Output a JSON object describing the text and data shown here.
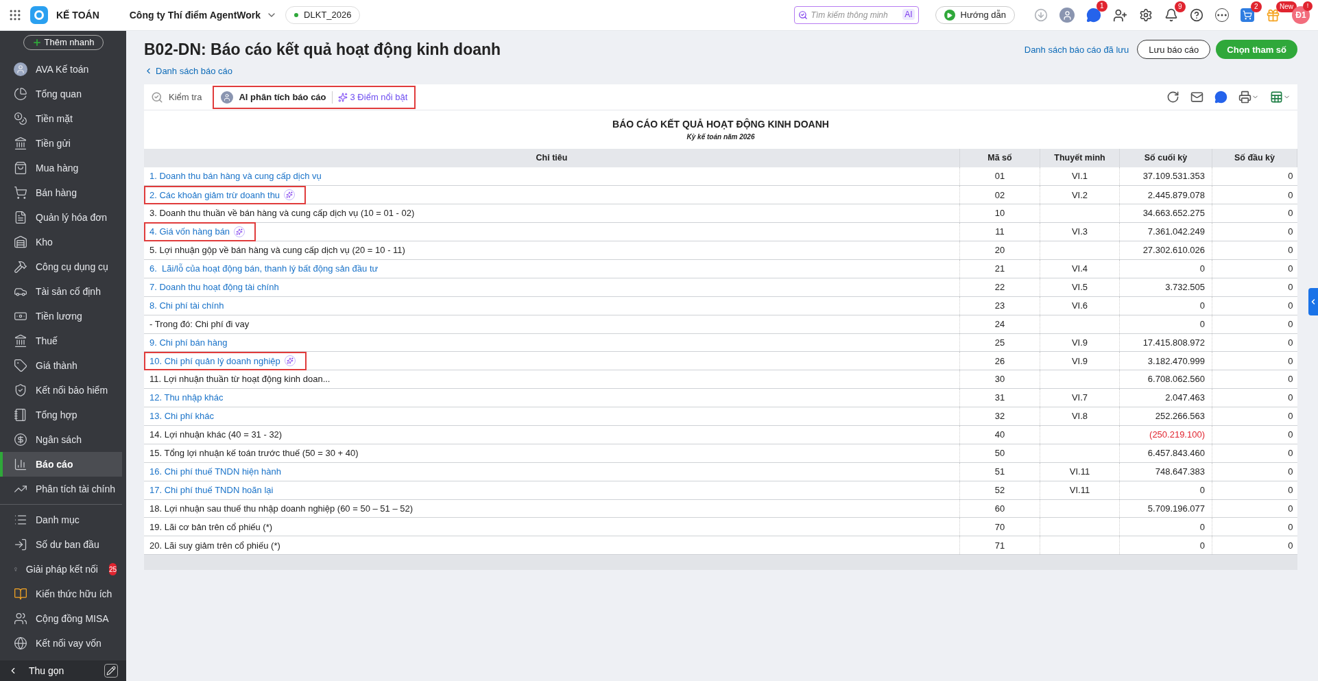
{
  "topbar": {
    "app_name": "KẾ TOÁN",
    "company": "Công ty Thí điểm AgentWork",
    "database": "DLKT_2026",
    "search": {
      "placeholder": "Tìm kiếm thông minh",
      "badge": "AI"
    },
    "guide_button": "Hướng dẫn",
    "icons": [
      {
        "kind": "download"
      },
      {
        "kind": "ai-avatar"
      },
      {
        "kind": "chat",
        "badge": "1"
      },
      {
        "kind": "add-user"
      },
      {
        "kind": "settings"
      },
      {
        "kind": "bell",
        "badge": "9"
      },
      {
        "kind": "help"
      },
      {
        "kind": "more"
      },
      {
        "kind": "cart",
        "badge": "2"
      },
      {
        "kind": "gift",
        "badge": "New"
      }
    ],
    "user": {
      "initials": "Đ1",
      "badge": "!"
    }
  },
  "sidebar": {
    "quick_add": "Thêm nhanh",
    "groups": [
      [
        {
          "label": "AVA Kế toán",
          "kind": "avatar",
          "selected": false
        },
        {
          "label": "Tổng quan",
          "kind": "overview",
          "selected": false
        },
        {
          "label": "Tiền mặt",
          "kind": "cash",
          "selected": false
        },
        {
          "label": "Tiền gửi",
          "kind": "deposit",
          "selected": false
        },
        {
          "label": "Mua hàng",
          "kind": "purchase",
          "selected": false
        },
        {
          "label": "Bán hàng",
          "kind": "sales",
          "selected": false
        },
        {
          "label": "Quản lý hóa đơn",
          "kind": "invoice",
          "selected": false
        },
        {
          "label": "Kho",
          "kind": "warehouse",
          "selected": false
        },
        {
          "label": "Công cụ dụng cụ",
          "kind": "tools",
          "selected": false
        },
        {
          "label": "Tài sản cố định",
          "kind": "asset",
          "selected": false
        },
        {
          "label": "Tiền lương",
          "kind": "salary",
          "selected": false
        },
        {
          "label": "Thuế",
          "kind": "tax",
          "selected": false
        },
        {
          "label": "Giá thành",
          "kind": "cost",
          "selected": false
        },
        {
          "label": "Kết nối bảo hiểm",
          "kind": "insurance",
          "selected": false
        },
        {
          "label": "Tổng hợp",
          "kind": "ledger",
          "selected": false
        },
        {
          "label": "Ngân sách",
          "kind": "budget",
          "selected": false
        },
        {
          "label": "Báo cáo",
          "kind": "report",
          "selected": true
        },
        {
          "label": "Phân tích tài chính",
          "kind": "analysis",
          "selected": false
        }
      ],
      [
        {
          "label": "Danh mục",
          "kind": "list",
          "selected": false
        },
        {
          "label": "Số dư ban đầu",
          "kind": "opening",
          "selected": false
        },
        {
          "label": "Giải pháp kết nối",
          "kind": "solution",
          "selected": false,
          "badge": "25"
        },
        {
          "label": "Kiến thức hữu ích",
          "kind": "knowledge",
          "selected": false
        },
        {
          "label": "Cộng đồng MISA",
          "kind": "community",
          "selected": false
        },
        {
          "label": "Kết nối vay vốn",
          "kind": "loan",
          "selected": false
        }
      ]
    ],
    "collapse": "Thu gọn"
  },
  "page": {
    "title": "B02-DN: Báo cáo kết quả hoạt động kinh doanh",
    "back_link": "Danh sách báo cáo",
    "saved_reports_link": "Danh sách báo cáo đã lưu",
    "save_button": "Lưu báo cáo",
    "params_button": "Chọn tham số"
  },
  "toolbar": {
    "check": "Kiểm tra",
    "ai_analysis": "AI phân tích báo cáo",
    "highlights": "3 Điểm nổi bật",
    "highlighted": true
  },
  "report": {
    "title": "BÁO CÁO KẾT QUẢ HOẠT ĐỘNG KINH DOANH",
    "subtitle": "Kỳ kế toán năm 2026",
    "columns": [
      "Chỉ tiêu",
      "Mã số",
      "Thuyết minh",
      "Số cuối kỳ",
      "Số đầu kỳ"
    ],
    "rows": [
      {
        "label": "1. Doanh thu bán hàng và cung cấp dịch vụ",
        "code": "01",
        "note": "VI.1",
        "end": "37.109.531.353",
        "start": "0",
        "link": true,
        "highlighted": false,
        "negative": false
      },
      {
        "label": "2. Các khoản giảm trừ doanh thu",
        "code": "02",
        "note": "VI.2",
        "end": "2.445.879.078",
        "start": "0",
        "link": true,
        "highlighted": true,
        "negative": false
      },
      {
        "label": "3. Doanh thu thuần về bán hàng và cung cấp dịch vụ (10 = 01 - 02)",
        "code": "10",
        "end": "34.663.652.275",
        "start": "0",
        "link": false,
        "highlighted": false,
        "negative": false
      },
      {
        "label": "4. Giá vốn hàng bán",
        "code": "11",
        "note": "VI.3",
        "end": "7.361.042.249",
        "start": "0",
        "link": true,
        "highlighted": true,
        "negative": false
      },
      {
        "label": "5. Lợi nhuận gộp về bán hàng và cung cấp dịch vụ (20 = 10 - 11)",
        "code": "20",
        "end": "27.302.610.026",
        "start": "0",
        "link": false,
        "highlighted": false,
        "negative": false
      },
      {
        "label": "6.  Lãi/lỗ của hoạt động bán, thanh lý bất động sản đầu tư",
        "code": "21",
        "note": "VI.4",
        "end": "0",
        "start": "0",
        "link": true,
        "highlighted": false,
        "negative": false
      },
      {
        "label": "7. Doanh thu hoạt động tài chính",
        "code": "22",
        "note": "VI.5",
        "end": "3.732.505",
        "start": "0",
        "link": true,
        "highlighted": false,
        "negative": false
      },
      {
        "label": "8. Chi phí tài chính",
        "code": "23",
        "note": "VI.6",
        "end": "0",
        "start": "0",
        "link": true,
        "highlighted": false,
        "negative": false
      },
      {
        "label": "- Trong đó: Chi phí đi vay",
        "code": "24",
        "end": "0",
        "start": "0",
        "link": false,
        "highlighted": false,
        "negative": false
      },
      {
        "label": "9. Chi phí bán hàng",
        "code": "25",
        "note": "VI.9",
        "end": "17.415.808.972",
        "start": "0",
        "link": true,
        "highlighted": false,
        "negative": false
      },
      {
        "label": "10. Chi phí quản lý doanh nghiệp",
        "code": "26",
        "note": "VI.9",
        "end": "3.182.470.999",
        "start": "0",
        "link": true,
        "highlighted": true,
        "negative": false
      },
      {
        "label": "11. Lợi nhuận thuần từ hoạt động kinh doan...",
        "code": "30",
        "end": "6.708.062.560",
        "start": "0",
        "link": false,
        "highlighted": false,
        "negative": false
      },
      {
        "label": "12. Thu nhập khác",
        "code": "31",
        "note": "VI.7",
        "end": "2.047.463",
        "start": "0",
        "link": true,
        "highlighted": false,
        "negative": false
      },
      {
        "label": "13. Chi phí khác",
        "code": "32",
        "note": "VI.8",
        "end": "252.266.563",
        "start": "0",
        "link": true,
        "highlighted": false,
        "negative": false
      },
      {
        "label": "14. Lợi nhuận khác (40 = 31 - 32)",
        "code": "40",
        "end": "(250.219.100)",
        "start": "0",
        "link": false,
        "highlighted": false,
        "negative": true
      },
      {
        "label": "15. Tổng lợi nhuận kế toán trước thuế (50 = 30 + 40)",
        "code": "50",
        "end": "6.457.843.460",
        "start": "0",
        "link": false,
        "highlighted": false,
        "negative": false
      },
      {
        "label": "16. Chi phí thuế TNDN hiện hành",
        "code": "51",
        "note": "VI.11",
        "end": "748.647.383",
        "start": "0",
        "link": true,
        "highlighted": false,
        "negative": false
      },
      {
        "label": "17. Chi phí thuế TNDN hoãn lại",
        "code": "52",
        "note": "VI.11",
        "end": "0",
        "start": "0",
        "link": true,
        "highlighted": false,
        "negative": false
      },
      {
        "label": "18. Lợi nhuận sau thuế thu nhập doanh nghiệp (60 = 50 – 51 – 52)",
        "code": "60",
        "end": "5.709.196.077",
        "start": "0",
        "link": false,
        "highlighted": false,
        "negative": false
      },
      {
        "label": "19. Lãi cơ bản trên cổ phiếu (*)",
        "code": "70",
        "end": "0",
        "start": "0",
        "link": false,
        "highlighted": false,
        "negative": false
      },
      {
        "label": "20. Lãi suy giảm trên cổ phiếu (*)",
        "code": "71",
        "end": "0",
        "start": "0",
        "link": false,
        "highlighted": false,
        "negative": false
      }
    ]
  }
}
